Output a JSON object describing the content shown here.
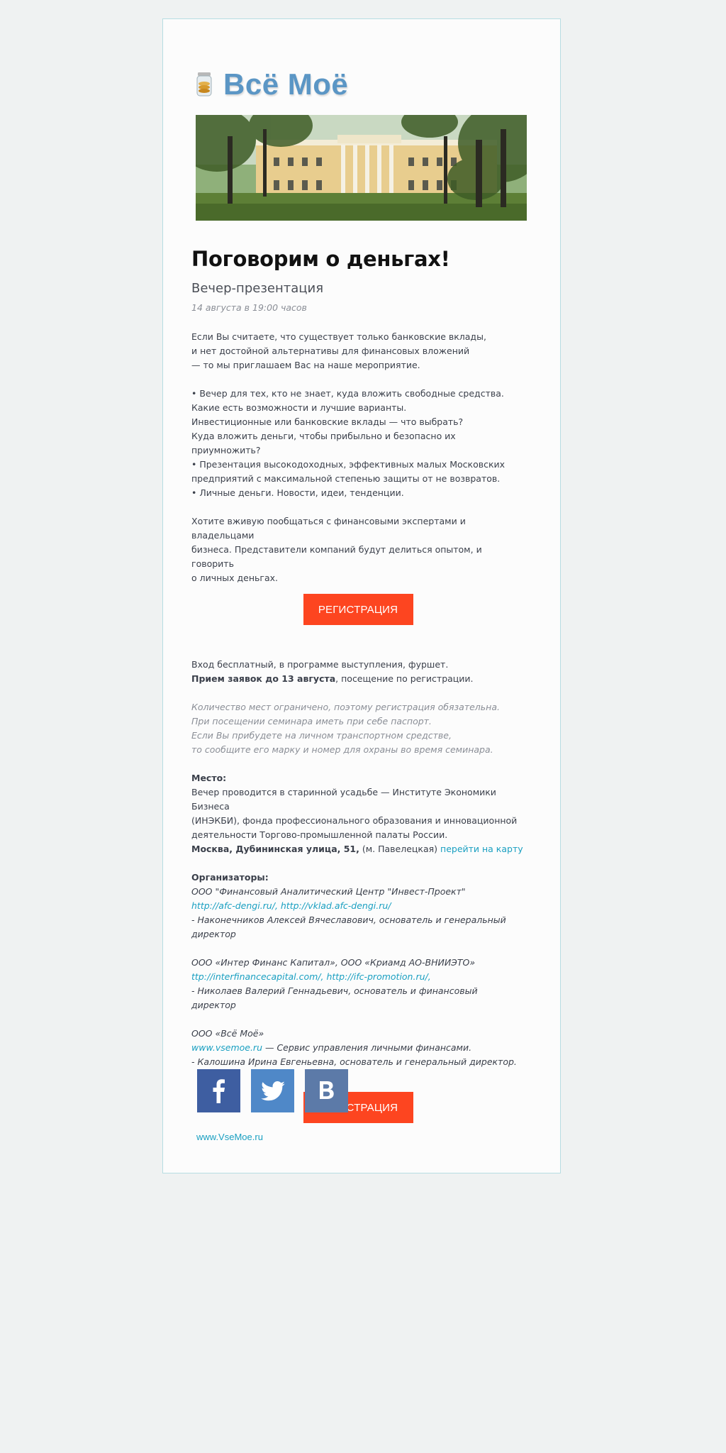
{
  "logo": {
    "text": "Всё Моё",
    "icon": "jar-of-coins-icon"
  },
  "title": "Поговорим о деньгах!",
  "subtitle": "Вечер-презентация",
  "date": "14 августа в 19:00 часов",
  "intro": [
    "Если Вы считаете, что существует только банковские вклады,",
    "и нет достойной альтернативы для финансовых вложений",
    "— то мы приглашаем Вас на наше мероприятие."
  ],
  "bullets": [
    "•  Вечер для тех, кто не знает, куда вложить свободные средства.",
    "Какие есть возможности и лучшие варианты.",
    "Инвестиционные или банковские вклады — что выбрать?",
    "Куда вложить деньги, чтобы прибыльно и безопасно их приумножить?",
    "•  Презентация высокодоходных, эффективных малых Московских",
    "предприятий с максимальной степенью защиты от не возвратов.",
    "•  Личные деньги. Новости, идеи, тенденции."
  ],
  "closing": [
    "Хотите вживую пообщаться с финансовыми экспертами и владельцами",
    "бизнеса. Представители компаний будут делиться опытом, и говорить",
    "о личных деньгах."
  ],
  "register_button": "РЕГИСТРАЦИЯ",
  "entry": {
    "line1": "Вход бесплатный, в программе выступления, фуршет.",
    "deadline_bold": "Прием заявок до 13 августа",
    "deadline_rest": ", посещение по регистрации."
  },
  "notes": [
    "Количество мест ограничено, поэтому регистрация обязательна.",
    "При посещении семинара иметь при себе паспорт.",
    "Если Вы прибудете на личном транспортном средстве,",
    "то сообщите его марку и номер для охраны во время семинара."
  ],
  "place": {
    "label": "Место:",
    "lines": [
      "Вечер проводится в старинной усадьбе — Институте Экономики Бизнеса",
      "(ИНЭКБИ), фонда профессионального образования и инновационной",
      "деятельности Торгово-промышленной палаты России."
    ],
    "address_bold": "Москва, Дубининская улица, 51,",
    "metro": " (м. Павелецкая) ",
    "map_link": "перейти на карту"
  },
  "organizers": {
    "label": "Организаторы:",
    "org1_name": "ООО \"Финансовый Аналитический Центр \"Инвест-Проект\"",
    "org1_links": "http://afc-dengi.ru/, http://vklad.afc-dengi.ru/",
    "org1_person": "- Наконечников Алексей Вячеславович, основатель и генеральный",
    "org1_person2": "директор",
    "org2_name": "ООО «Интер Финанс Капитал», ООО «Криамд АО-ВНИИЭТО»",
    "org2_links": "ttp://interfinancecapital.com/, http://ifc-promotion.ru/,",
    "org2_person": "- Николаев Валерий Геннадьевич, основатель и финансовый директор",
    "org3_name": "ООО «Всё Моё»",
    "org3_link": "www.vsemoe.ru",
    "org3_desc": " — Сервис управления личными финансами.",
    "org3_person": "- Калошина Ирина Евгеньевна, основатель и генеральный директор."
  },
  "social": {
    "facebook": "facebook-icon",
    "twitter": "twitter-icon",
    "vk": "vk-icon"
  },
  "footer_link": "www.VseMoe.ru"
}
